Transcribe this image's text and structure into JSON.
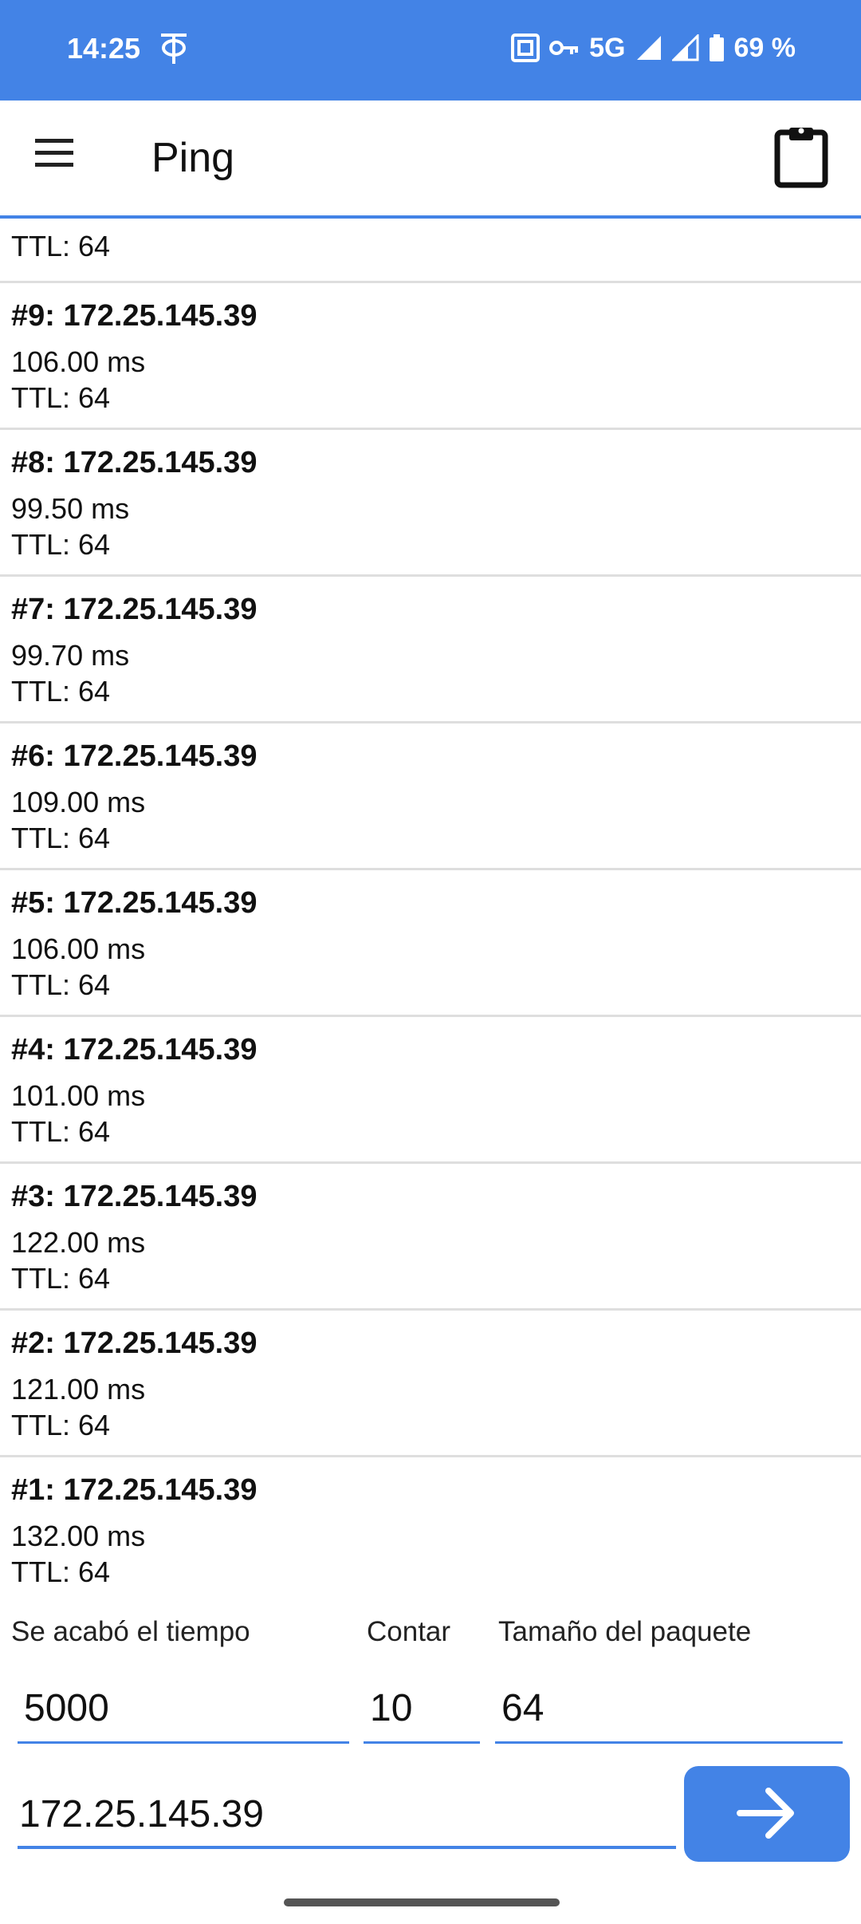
{
  "status_bar": {
    "time": "14:25",
    "network": "5G",
    "battery": "69 %",
    "icons": [
      "data-saver-icon",
      "nfc-icon",
      "vpn-key-icon",
      "signal-icon",
      "signal-roaming-icon",
      "battery-icon"
    ]
  },
  "app_bar": {
    "title": "Ping",
    "menu_icon": "hamburger-menu-icon",
    "action_icon": "clipboard-icon"
  },
  "results": {
    "partial_top_ttl": "TTL: 64",
    "items": [
      {
        "title": "#9: 172.25.145.39",
        "time": "106.00 ms",
        "ttl": "TTL: 64"
      },
      {
        "title": "#8: 172.25.145.39",
        "time": "99.50 ms",
        "ttl": "TTL: 64"
      },
      {
        "title": "#7: 172.25.145.39",
        "time": "99.70 ms",
        "ttl": "TTL: 64"
      },
      {
        "title": "#6: 172.25.145.39",
        "time": "109.00 ms",
        "ttl": "TTL: 64"
      },
      {
        "title": "#5: 172.25.145.39",
        "time": "106.00 ms",
        "ttl": "TTL: 64"
      },
      {
        "title": "#4: 172.25.145.39",
        "time": "101.00 ms",
        "ttl": "TTL: 64"
      },
      {
        "title": "#3: 172.25.145.39",
        "time": "122.00 ms",
        "ttl": "TTL: 64"
      },
      {
        "title": "#2: 172.25.145.39",
        "time": "121.00 ms",
        "ttl": "TTL: 64"
      },
      {
        "title": "#1: 172.25.145.39",
        "time": "132.00 ms",
        "ttl": "TTL: 64"
      }
    ]
  },
  "params": {
    "timeout_label": "Se acabó el tiempo",
    "timeout_value": "5000",
    "count_label": "Contar",
    "count_value": "10",
    "size_label": "Tamaño del paquete",
    "size_value": "64"
  },
  "host": {
    "value": "172.25.145.39",
    "go_icon": "arrow-right-icon"
  },
  "colors": {
    "accent": "#4383e6",
    "divider": "#dedede"
  }
}
